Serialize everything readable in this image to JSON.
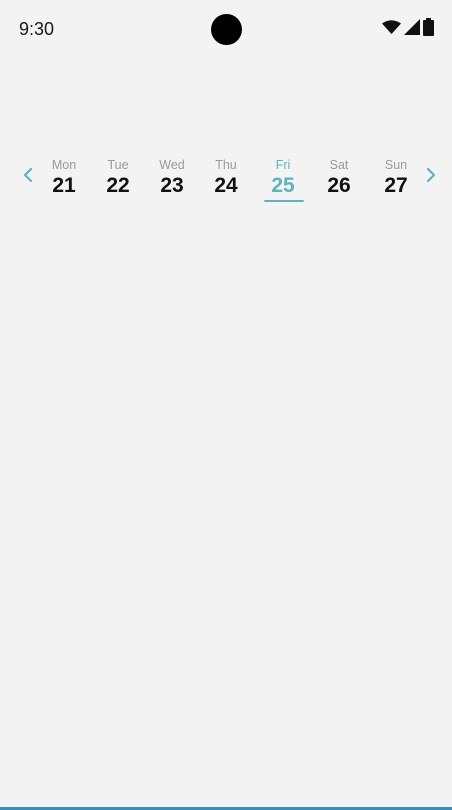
{
  "status_bar": {
    "time": "9:30",
    "icons": [
      "wifi-icon",
      "signal-icon",
      "battery-icon"
    ]
  },
  "week": {
    "prev_icon": "chevron-left-icon",
    "next_icon": "chevron-right-icon",
    "days": [
      {
        "name": "Mon",
        "number": "21"
      },
      {
        "name": "Tue",
        "number": "22"
      },
      {
        "name": "Wed",
        "number": "23"
      },
      {
        "name": "Thu",
        "number": "24"
      },
      {
        "name": "Fri",
        "number": "25"
      },
      {
        "name": "Sat",
        "number": "26"
      },
      {
        "name": "Sun",
        "number": "27"
      }
    ],
    "selected_index": 4
  },
  "colors": {
    "accent": "#5bb5bd",
    "background": "#f3f3f3",
    "bottom_bar": "#2b8fd0"
  }
}
